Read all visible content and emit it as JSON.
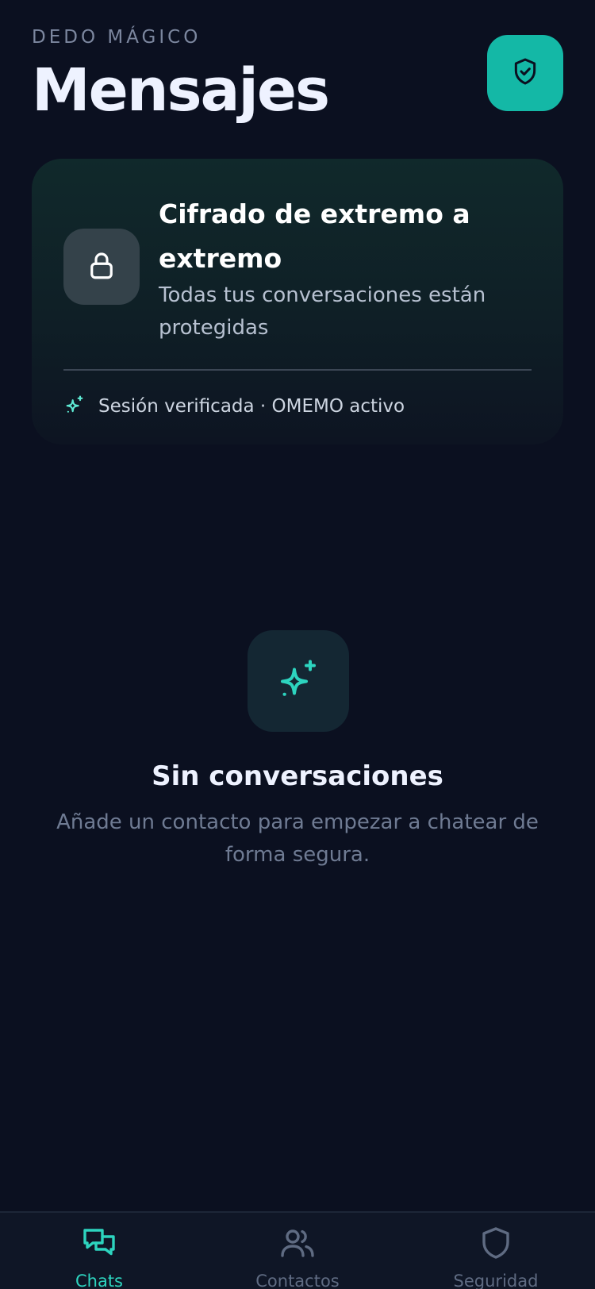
{
  "header": {
    "overline": "DEDO MÁGICO",
    "title": "Mensajes",
    "action_icon": "shield-check-icon"
  },
  "encryption_card": {
    "icon": "lock-icon",
    "title": "Cifrado de extremo a extremo",
    "subtitle": "Todas tus conversaciones están protegidas",
    "footer_icon": "sparkles-icon",
    "footer_text": "Sesión verificada · OMEMO activo"
  },
  "empty_state": {
    "icon": "sparkles-icon",
    "title": "Sin conversaciones",
    "subtitle": "Añade un contacto para empezar a chatear de forma segura."
  },
  "tabbar": {
    "tabs": [
      {
        "label": "Chats",
        "icon": "chat-bubbles-icon",
        "active": true
      },
      {
        "label": "Contactos",
        "icon": "users-icon",
        "active": false
      },
      {
        "label": "Seguridad",
        "icon": "shield-icon",
        "active": false
      }
    ]
  },
  "colors": {
    "background": "#0b1020",
    "accent": "#14b8a6",
    "accent_light": "#2dd4bf",
    "muted": "#6f7b93"
  }
}
